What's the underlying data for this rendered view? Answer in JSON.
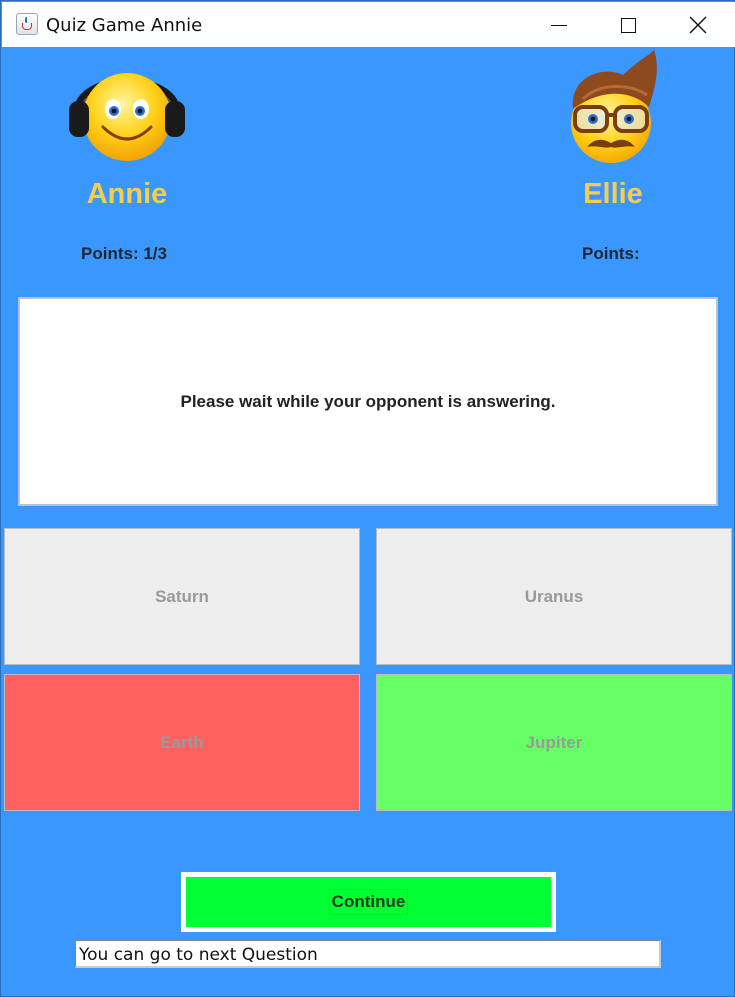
{
  "window": {
    "title": "Quiz Game Annie"
  },
  "players": {
    "left": {
      "name": "Annie",
      "points_label": "Points:",
      "points_value": "1/3",
      "avatar": "smiley-headphones-icon"
    },
    "right": {
      "name": "Ellie",
      "points_label": "Points:",
      "points_value": "",
      "avatar": "smiley-glasses-mustache-icon"
    }
  },
  "question": {
    "text": "Please wait while your opponent is answering."
  },
  "answers": [
    {
      "label": "Saturn",
      "state": "neutral",
      "color": "#eeeeee"
    },
    {
      "label": "Uranus",
      "state": "neutral",
      "color": "#eeeeee"
    },
    {
      "label": "Earth",
      "state": "wrong",
      "color": "#ff6161"
    },
    {
      "label": "Jupiter",
      "state": "correct",
      "color": "#66ff66"
    }
  ],
  "continue_button": {
    "label": "Continue",
    "color": "#00ff33"
  },
  "status": {
    "text": "You can go to next Question"
  },
  "colors": {
    "background": "#3a97fe",
    "player_name": "#f7cd4a"
  }
}
